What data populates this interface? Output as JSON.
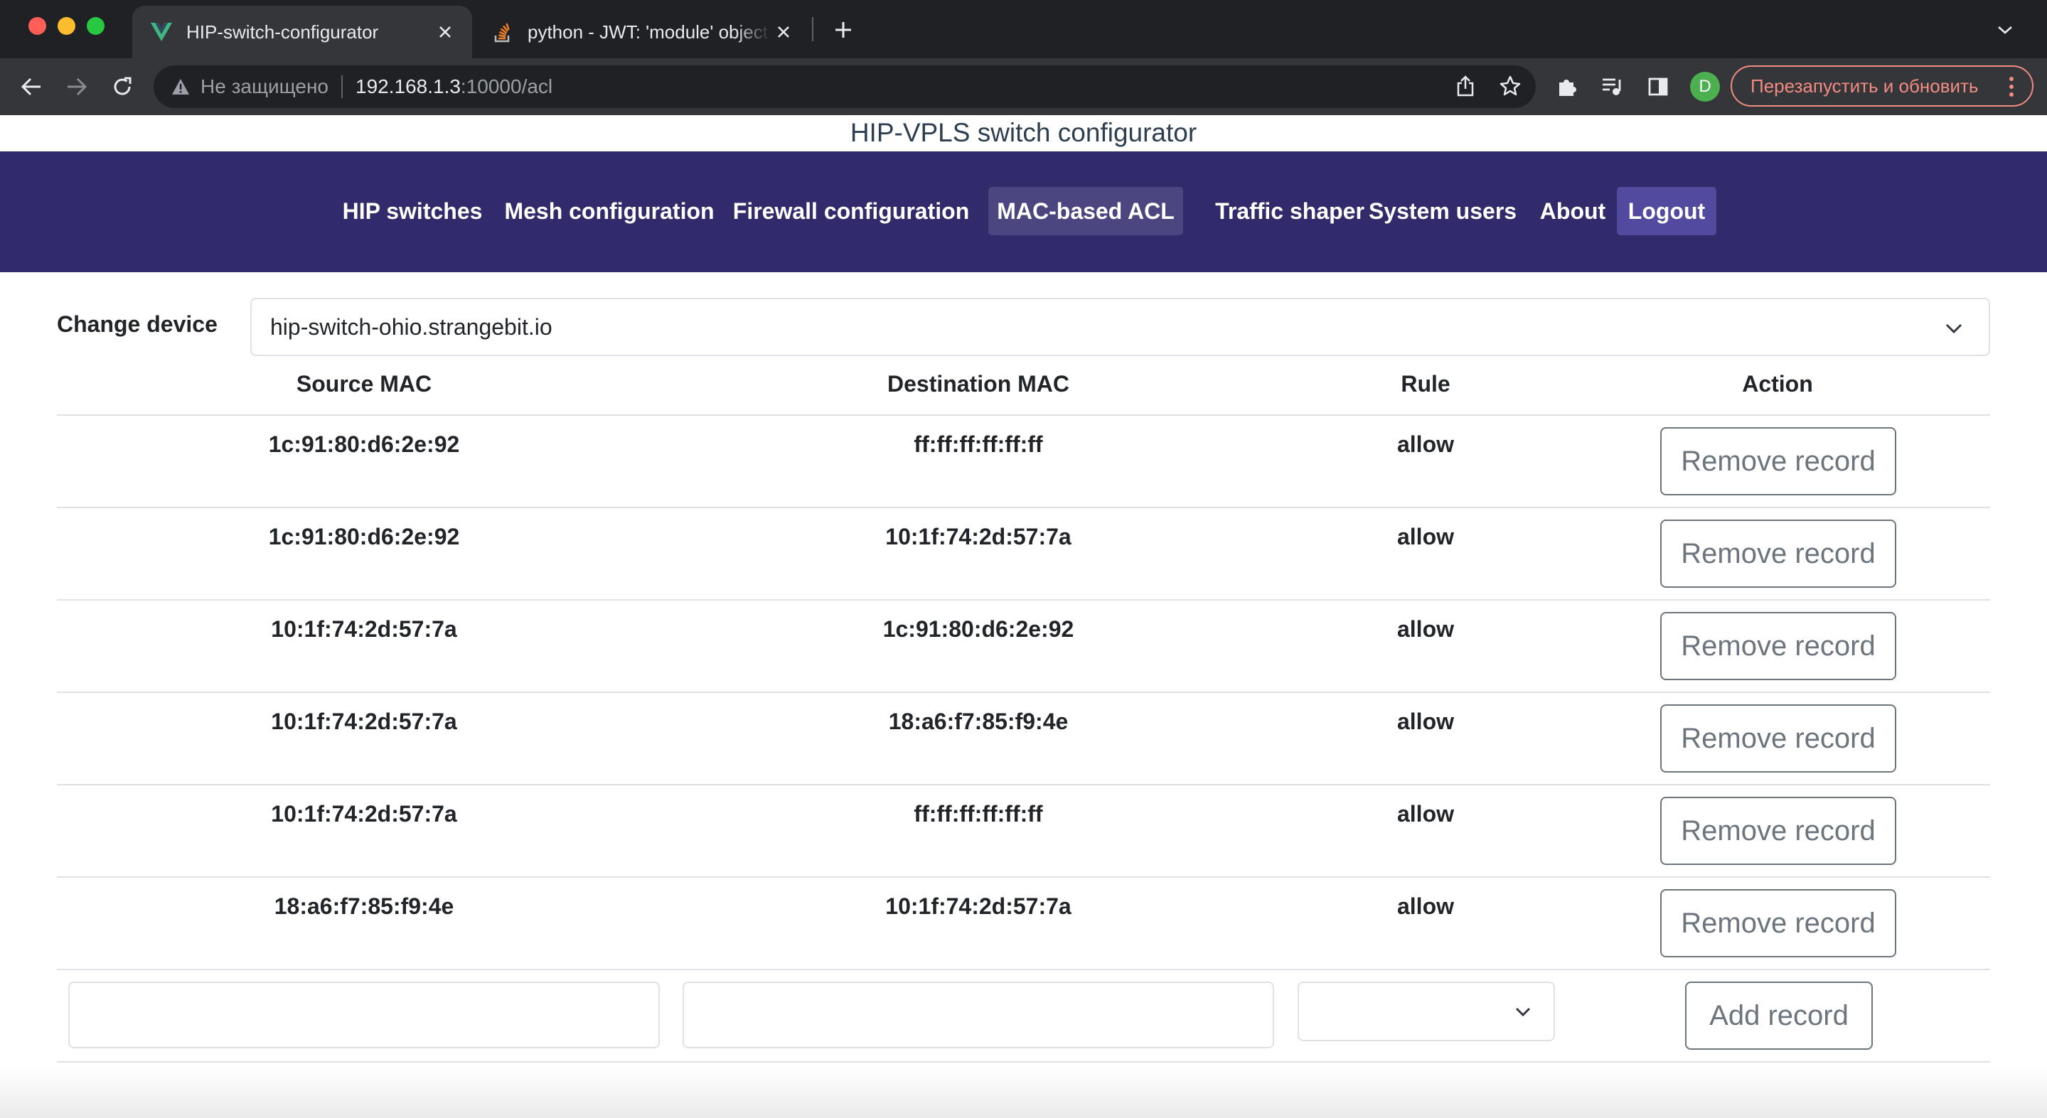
{
  "browser": {
    "tabs": [
      {
        "title": "HIP-switch-configurator",
        "favicon": "vue-logo-icon",
        "active": true
      },
      {
        "title": "python - JWT: 'module' object has no attribute 'encode'",
        "favicon": "stackoverflow-icon",
        "active": false
      }
    ],
    "address": {
      "security_label": "Не защищено",
      "host": "192.168.1.3",
      "path": ":10000/acl"
    },
    "profile_initial": "D",
    "relaunch_label": "Перезапустить и обновить"
  },
  "app": {
    "header_title": "HIP-VPLS switch configurator",
    "nav": [
      {
        "label": "HIP switches"
      },
      {
        "label": "Mesh configuration"
      },
      {
        "label": "Firewall configuration"
      },
      {
        "label": "MAC-based ACL",
        "active": true
      },
      {
        "label": "Traffic shaper"
      },
      {
        "label": "System users"
      },
      {
        "label": "About"
      },
      {
        "label": "Logout"
      }
    ],
    "colors": {
      "navbar": "#322b6b",
      "active_nav": "#4b4680",
      "logout": "#514a9f"
    }
  },
  "device": {
    "label": "Change device",
    "selected": "hip-switch-ohio.strangebit.io"
  },
  "acl_table": {
    "headers": [
      "Source MAC",
      "Destination MAC",
      "Rule",
      "Action"
    ],
    "rows": [
      {
        "source": "1c:91:80:d6:2e:92",
        "destination": "ff:ff:ff:ff:ff:ff",
        "rule": "allow",
        "action": "Remove record"
      },
      {
        "source": "1c:91:80:d6:2e:92",
        "destination": "10:1f:74:2d:57:7a",
        "rule": "allow",
        "action": "Remove record"
      },
      {
        "source": "10:1f:74:2d:57:7a",
        "destination": "1c:91:80:d6:2e:92",
        "rule": "allow",
        "action": "Remove record"
      },
      {
        "source": "10:1f:74:2d:57:7a",
        "destination": "18:a6:f7:85:f9:4e",
        "rule": "allow",
        "action": "Remove record"
      },
      {
        "source": "10:1f:74:2d:57:7a",
        "destination": "ff:ff:ff:ff:ff:ff",
        "rule": "allow",
        "action": "Remove record"
      },
      {
        "source": "18:a6:f7:85:f9:4e",
        "destination": "10:1f:74:2d:57:7a",
        "rule": "allow",
        "action": "Remove record"
      }
    ],
    "new_record": {
      "source_value": "",
      "destination_value": "",
      "rule_value": "",
      "add_label": "Add record"
    }
  }
}
